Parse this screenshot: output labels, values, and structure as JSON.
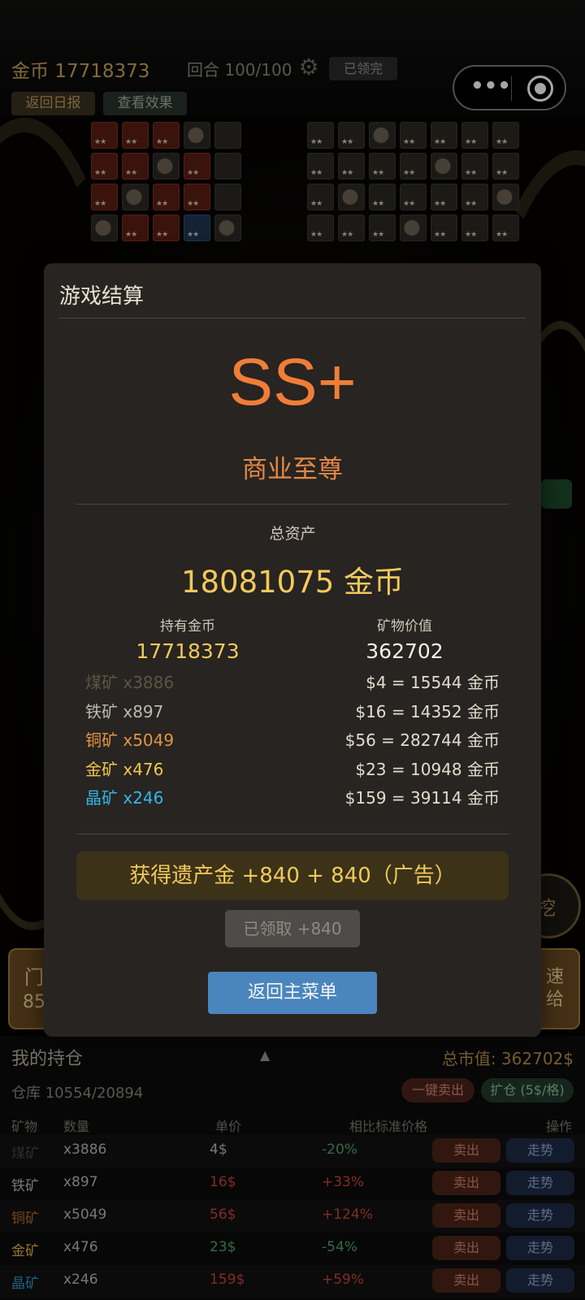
{
  "status": {
    "coins_label": "金币 17718373",
    "round_label": "回合 100/100",
    "claimed_tag": "已领完",
    "btn_report": "返回日报",
    "btn_effect": "查看效果",
    "capsule_more": "•••"
  },
  "side": {
    "dig_label": "挖",
    "left_label": "门",
    "left_number": "85",
    "right_label": "速\n给"
  },
  "modal": {
    "title": "游戏结算",
    "grade": "SS+",
    "grade_name": "商业至尊",
    "total_label": "总资产",
    "total_value": "18081075 金币",
    "held_coins_label": "持有金币",
    "held_coins_value": "17718373",
    "ore_value_label": "矿物价值",
    "ore_value_value": "362702",
    "ores": [
      {
        "name": "煤矿 x3886",
        "value": "$4 = 15544 金币",
        "color": "#5e5446"
      },
      {
        "name": "铁矿 x897",
        "value": "$16 = 14352 金币",
        "color": "#bdb8ae"
      },
      {
        "name": "铜矿 x5049",
        "value": "$56 = 282744 金币",
        "color": "#e39346"
      },
      {
        "name": "金矿 x476",
        "value": "$23 = 10948 金币",
        "color": "#f2c64a"
      },
      {
        "name": "晶矿 x246",
        "value": "$159 = 39114 金币",
        "color": "#33b6ea"
      }
    ],
    "legacy_label": "获得遗产金  +840 + 840（广告）",
    "claimed_label": "已领取 +840",
    "back_label": "返回主菜单"
  },
  "holdings": {
    "title": "我的持仓",
    "arrow": "▲",
    "total": "总市值: 362702$",
    "storage": "仓库 10554/20894",
    "sell_all": "一键卖出",
    "expand": "扩仓 (5$/格)",
    "columns": [
      "矿物",
      "数量",
      "单价",
      "相比标准价格",
      "操作"
    ],
    "rows": [
      {
        "name": "煤矿",
        "qty": "x3886",
        "price": "4$",
        "diff": "-20%",
        "name_color": "#4a4338",
        "price_color": "#bdb8ae",
        "diff_color": "#4fa66a"
      },
      {
        "name": "铁矿",
        "qty": "x897",
        "price": "16$",
        "diff": "+33%",
        "name_color": "#bdb8ae",
        "price_color": "#c9443a",
        "diff_color": "#c9443a"
      },
      {
        "name": "铜矿",
        "qty": "x5049",
        "price": "56$",
        "diff": "+124%",
        "name_color": "#b06a33",
        "price_color": "#c9443a",
        "diff_color": "#c9443a"
      },
      {
        "name": "金矿",
        "qty": "x476",
        "price": "23$",
        "diff": "-54%",
        "name_color": "#e0b543",
        "price_color": "#4fa66a",
        "diff_color": "#4fa66a"
      },
      {
        "name": "晶矿",
        "qty": "x246",
        "price": "159$",
        "diff": "+59%",
        "name_color": "#2f95c8",
        "price_color": "#c9443a",
        "diff_color": "#c9443a"
      }
    ],
    "sell_label": "卖出",
    "trend_label": "走势"
  }
}
